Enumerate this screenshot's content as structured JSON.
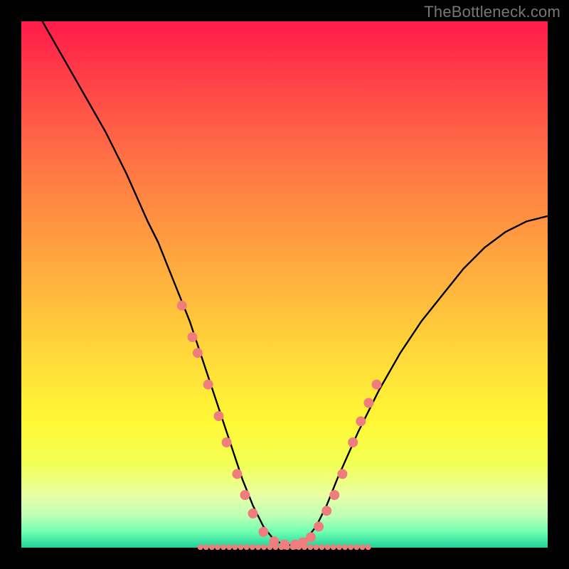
{
  "watermark": "TheBottleneck.com",
  "chart_data": {
    "type": "line",
    "title": "",
    "xlabel": "",
    "ylabel": "",
    "xlim": [
      0,
      100
    ],
    "ylim": [
      0,
      100
    ],
    "series": [
      {
        "name": "curve",
        "x": [
          4,
          8,
          12,
          16,
          20,
          24,
          26,
          28,
          30,
          32,
          34,
          36,
          38,
          40,
          42,
          44,
          46,
          48,
          50,
          52,
          54,
          56,
          58,
          60,
          64,
          68,
          72,
          76,
          80,
          84,
          88,
          92,
          96,
          100
        ],
        "y": [
          100,
          93,
          86,
          79,
          71,
          62,
          58,
          53,
          48,
          43,
          37,
          31,
          25,
          19,
          13,
          8,
          4,
          1.5,
          0.5,
          0.5,
          1.5,
          4,
          8,
          13,
          22,
          30,
          37,
          43,
          48,
          53,
          57,
          60,
          62,
          63
        ]
      }
    ],
    "markers": {
      "name": "highlight-dots",
      "color": "#f07d7d",
      "dot_radius": 7,
      "band_radius": 4,
      "points": [
        {
          "x": 30.5,
          "y": 46
        },
        {
          "x": 32.5,
          "y": 40
        },
        {
          "x": 33.5,
          "y": 37
        },
        {
          "x": 35.5,
          "y": 31
        },
        {
          "x": 37.5,
          "y": 25
        },
        {
          "x": 39,
          "y": 20
        },
        {
          "x": 41,
          "y": 14
        },
        {
          "x": 42.5,
          "y": 10
        },
        {
          "x": 44,
          "y": 6.5
        },
        {
          "x": 46,
          "y": 3
        },
        {
          "x": 48,
          "y": 1.2
        },
        {
          "x": 50,
          "y": 0.6
        },
        {
          "x": 52,
          "y": 0.6
        },
        {
          "x": 53.5,
          "y": 1
        },
        {
          "x": 55,
          "y": 2
        },
        {
          "x": 56.5,
          "y": 4
        },
        {
          "x": 58,
          "y": 7
        },
        {
          "x": 59.5,
          "y": 10
        },
        {
          "x": 61,
          "y": 14
        },
        {
          "x": 63,
          "y": 20
        },
        {
          "x": 64.5,
          "y": 24
        },
        {
          "x": 66,
          "y": 27.5
        },
        {
          "x": 67.5,
          "y": 31
        }
      ],
      "band_y": 0.1
    }
  }
}
